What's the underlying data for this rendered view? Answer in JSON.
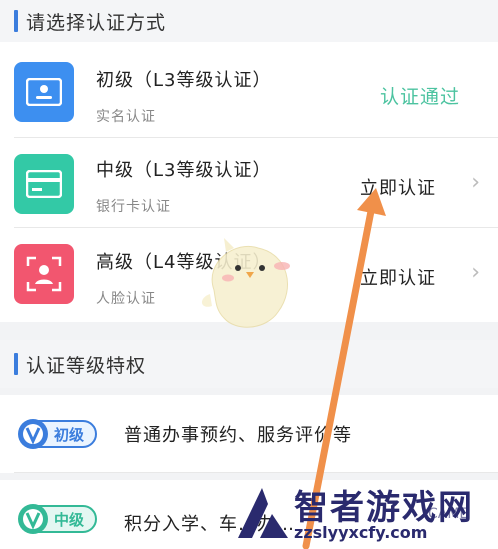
{
  "section_verify": {
    "title": "请选择认证方式"
  },
  "methods": [
    {
      "title": "初级（L3等级认证）",
      "subtitle": "实名认证",
      "action": "认证通过",
      "action_color": "#4cc3a0",
      "icon": "id-card-icon",
      "icon_bg": "#3d8ff0"
    },
    {
      "title": "中级（L3等级认证）",
      "subtitle": "银行卡认证",
      "action": "立即认证",
      "action_color": "#222222",
      "icon": "bank-card-icon",
      "icon_bg": "#33c9a6"
    },
    {
      "title": "高级（L4等级认证）",
      "subtitle": "人脸认证",
      "action": "立即认证",
      "action_color": "#222222",
      "icon": "face-scan-icon",
      "icon_bg": "#f2566f"
    }
  ],
  "section_priv": {
    "title": "认证等级特权"
  },
  "privileges": [
    {
      "badge": "初级",
      "text": "普通办事预约、服务评价等"
    },
    {
      "badge": "中级",
      "text": "积分入学、车…办…"
    }
  ],
  "watermark": {
    "title": "智者游戏网",
    "url": "zzslyyxcfy.com",
    "badge_text": "CAME"
  },
  "colors": {
    "accent_bar": "#3b7ddd",
    "arrow": "#f0904a"
  }
}
